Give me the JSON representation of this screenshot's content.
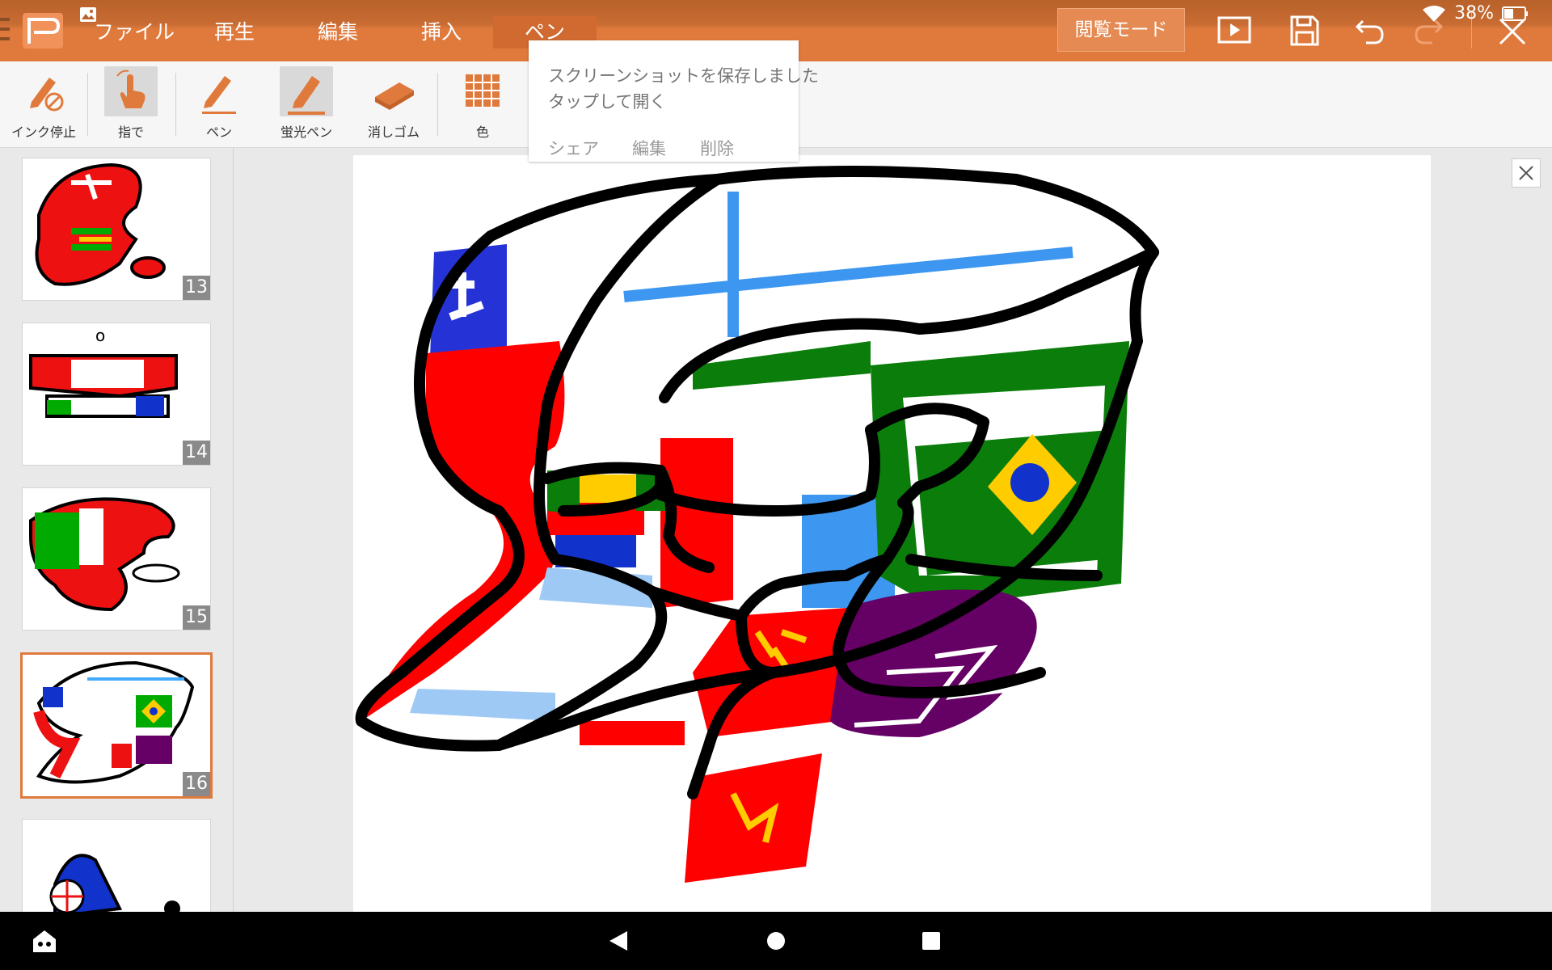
{
  "status": {
    "battery": "38%"
  },
  "menu": {
    "items": [
      "ファイル",
      "再生",
      "編集",
      "挿入",
      "ペン"
    ],
    "active_index": 4,
    "read_mode": "閲覧モード"
  },
  "toolbar": {
    "tools": [
      {
        "label": "インク停止",
        "icon": "ink-stop-icon"
      },
      {
        "label": "指で",
        "icon": "finger-icon",
        "selected": true
      },
      {
        "label": "ペン",
        "icon": "pen-icon"
      },
      {
        "label": "蛍光ペン",
        "icon": "highlighter-icon",
        "selected": true
      },
      {
        "label": "消しゴム",
        "icon": "eraser-icon"
      },
      {
        "label": "色",
        "icon": "color-grid-icon"
      }
    ]
  },
  "slides": {
    "numbers": [
      "13",
      "14",
      "15",
      "16"
    ],
    "selected": "16"
  },
  "toast": {
    "line1": "スクリーンショットを保存しました",
    "line2": "タップして開く",
    "actions": [
      "シェア",
      "編集",
      "削除"
    ]
  },
  "colors": {
    "accent": "#e07a3c",
    "toolbar_bg": "#f6f6f6",
    "panel_bg": "#e9e9e9"
  }
}
